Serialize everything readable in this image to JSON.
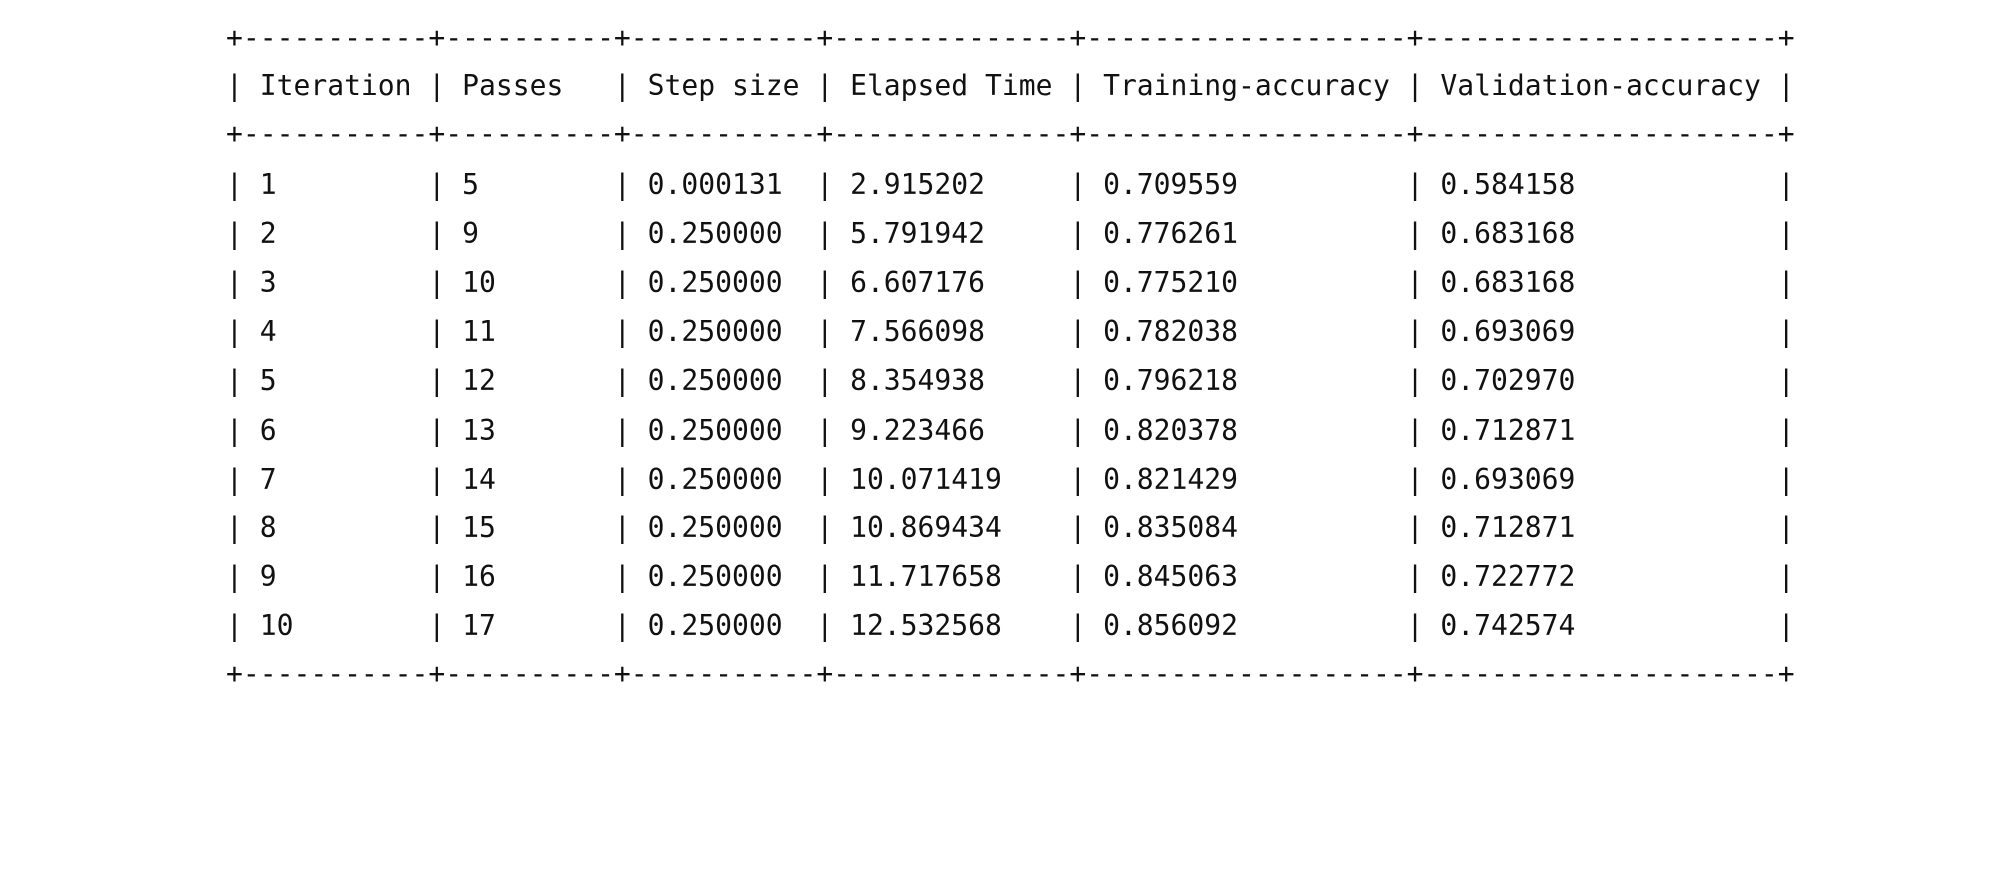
{
  "table": {
    "columns": [
      "Iteration",
      "Passes",
      "Step size",
      "Elapsed Time",
      "Training-accuracy",
      "Validation-accuracy"
    ],
    "rows": [
      [
        "1",
        "5",
        "0.000131",
        "2.915202",
        "0.709559",
        "0.584158"
      ],
      [
        "2",
        "9",
        "0.250000",
        "5.791942",
        "0.776261",
        "0.683168"
      ],
      [
        "3",
        "10",
        "0.250000",
        "6.607176",
        "0.775210",
        "0.683168"
      ],
      [
        "4",
        "11",
        "0.250000",
        "7.566098",
        "0.782038",
        "0.693069"
      ],
      [
        "5",
        "12",
        "0.250000",
        "8.354938",
        "0.796218",
        "0.702970"
      ],
      [
        "6",
        "13",
        "0.250000",
        "9.223466",
        "0.820378",
        "0.712871"
      ],
      [
        "7",
        "14",
        "0.250000",
        "10.071419",
        "0.821429",
        "0.693069"
      ],
      [
        "8",
        "15",
        "0.250000",
        "10.869434",
        "0.835084",
        "0.712871"
      ],
      [
        "9",
        "16",
        "0.250000",
        "11.717658",
        "0.845063",
        "0.722772"
      ],
      [
        "10",
        "17",
        "0.250000",
        "12.532568",
        "0.856092",
        "0.742574"
      ]
    ]
  }
}
